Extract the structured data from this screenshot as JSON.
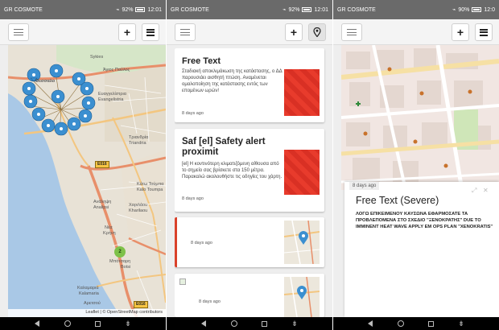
{
  "status": {
    "carrier": "GR COSMOTE",
    "screens": [
      {
        "battery": "92%",
        "time": "12:01"
      },
      {
        "battery": "92%",
        "time": "12:01"
      },
      {
        "battery": "90%",
        "time": "12:0"
      }
    ]
  },
  "map": {
    "labels": {
      "agios_pavlos": "Άγιος Παύλος",
      "sykies": "Sykies",
      "thessaloniki": "Θεσσαλο",
      "evangelistria": "Ευαγγελίστρια",
      "evangelistria_lat": "Evangelistria",
      "triandria": "Τριανδρία",
      "triandria_lat": "Triandria",
      "kato_toumpa": "Κάτω Τούμπα",
      "kato_toumpa_lat": "Kato Toumpa",
      "analipsi": "Ανάληψη",
      "analipsi_lat": "Analipsi",
      "charilaou": "Χαριλάου",
      "charilaou_lat": "Kharilaou",
      "nea_krini": "Νέα",
      "krini": "Κρήνη",
      "mpotsari": "Μπότσαρη",
      "mpotsari_lat": "Botsi",
      "kalamaria": "Καλαμαριά",
      "kalamaria_lat": "Kalamaria",
      "aretsou": "Αρετσού"
    },
    "road_badges": [
      "E016",
      "E016"
    ],
    "cluster_count": "2",
    "attribution": "Leaflet | © OpenStreetMap contributors"
  },
  "feed": {
    "cards": [
      {
        "title": "Free Text",
        "body": "Σταδιακή αποκλιμάκωση της κατάστασης, ο ΔΔ παρουσιάει αισθητή πτώση. Αναμένεται ομαλοποίηση της κατάστασης εντός των επομένων ωρών!",
        "time": "8 days ago"
      },
      {
        "title": "Saf [el] Safety alert proximit",
        "body": "[el] Η κοντινότερη κλιματιζόμενη αίθουσα από το σημείο σας βρίσκετε στα 150 μέτρα. Παρακαλώ ακολουθήστε τις οδηγίες του χάρτη.",
        "time": "8 days ago"
      },
      {
        "time": "8 days ago"
      },
      {
        "time": "8 days ago"
      }
    ]
  },
  "detail": {
    "time": "8 days ago",
    "title": "Free Text (Severe)",
    "body": "ΛΟΓΩ ΕΠΙΚΕΙΜΕΝΟΥ ΚΑΥΣΩΝΑ ΕΦΑΡΜΟΣΑΤΕ ΤΑ ΠΡΟΒΛΕΠΟΜΕΝΑ ΣΤΟ ΣΧΕΔΙΟ \"ΞΕΝΟΚΡΑΤΗΣ\" DUE TO IMMINENT HEAT WAVE APPLY EM OPS PLAN \"XENOKRATIS\""
  },
  "icons": {
    "menu": "hamburger-menu-icon",
    "add": "plus-icon",
    "list": "list-icon",
    "map_marker": "map-marker-icon",
    "expand": "expand-icon",
    "close": "close-icon"
  },
  "colors": {
    "marker": "#3b8fd0",
    "alert_red": "#e83b2c",
    "cluster": "#7fc24a",
    "statusbar": "#6a6a6a"
  }
}
